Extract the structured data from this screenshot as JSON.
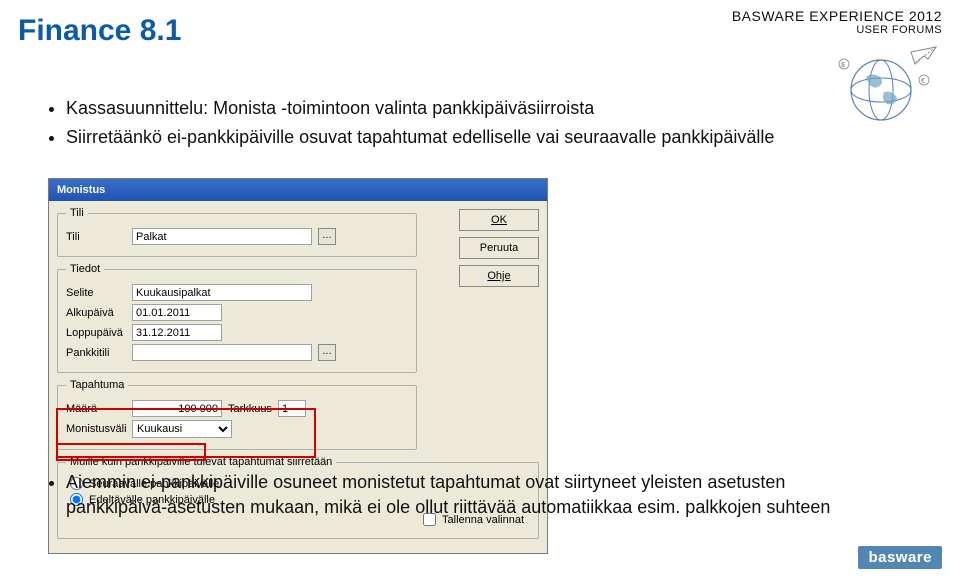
{
  "header": {
    "brand_line1": "BASWARE EXPERIENCE 2012",
    "brand_line2": "USER FORUMS"
  },
  "title": "Finance 8.1",
  "bullets_top": [
    "Kassasuunnittelu: Monista -toimintoon valinta pankkipäiväsiirroista",
    "Siirretäänkö ei-pankkipäiville osuvat tapahtumat edelliselle vai seuraavalle pankkipäivälle"
  ],
  "bullets_bottom": [
    "Aiemmin ei-pankkipäiville osuneet monistetut tapahtumat ovat siirtyneet yleisten asetusten pankkipäivä-asetusten mukaan, mikä ei ole ollut riittävää automatiikkaa esim. palkkojen suhteen"
  ],
  "dialog": {
    "title": "Monistus",
    "buttons": {
      "ok": "OK",
      "cancel": "Peruuta",
      "help": "Ohje"
    },
    "fs_tili": {
      "legend": "Tili",
      "label_tili": "Tili",
      "value_tili": "Palkat"
    },
    "fs_tiedot": {
      "legend": "Tiedot",
      "label_selite": "Selite",
      "value_selite": "Kuukausipalkat",
      "label_alku": "Alkupäivä",
      "value_alku": "01.01.2011",
      "label_loppu": "Loppupäivä",
      "value_loppu": "31.12.2011",
      "label_pankkitili": "Pankkitili",
      "value_pankkitili": ""
    },
    "fs_tapahtuma": {
      "legend": "Tapahtuma",
      "label_maara": "Määrä",
      "value_maara": "100 000",
      "label_tarkkuus": "Tarkkuus",
      "value_tarkkuus": "1",
      "label_vali": "Monistusväli",
      "value_vali": "Kuukausi"
    },
    "fs_siirto": {
      "legend": "Muille kuin pankkipäiville tulevat tapahtumat siirretään",
      "opt1": "Seuraavalle pankkipäivälle",
      "opt2": "Edeltävälle pankkipäivälle"
    },
    "chk_tallenna": "Tallenna valinnat"
  },
  "footer": {
    "logo": "basware"
  }
}
